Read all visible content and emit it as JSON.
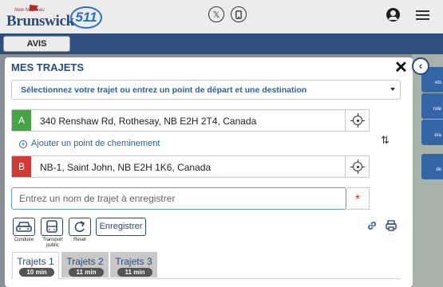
{
  "header": {
    "logo": {
      "small_text": "New Nouveau",
      "brand": "Brunswick",
      "number": "511"
    },
    "social_x_icon": "x-icon",
    "social_phone_icon": "mobile-icon",
    "user_icon": "user-icon",
    "menu_icon": "hamburger-icon"
  },
  "avis_label": "AVIS",
  "side_tabs": [
    "ets",
    "nde",
    "éra",
    "de"
  ],
  "panel": {
    "title": "MES TRAJETS",
    "close": "✕",
    "back": "‹",
    "select_placeholder": "Sélectionnez votre trajet ou entrez un point de départ et une destination",
    "start": {
      "letter": "A",
      "value": "340 Renshaw Rd, Rothesay, NB E2H 2T4, Canada"
    },
    "add_waypoint": "Ajouter un point de cheminement",
    "end": {
      "letter": "B",
      "value": "NB-1, Saint John, NB E2H 1K6, Canada"
    },
    "swap_icon": "⇅",
    "name_placeholder": "Entrez un nom de trajet à enregistrer",
    "required_mark": "*",
    "modes": [
      {
        "label": "Conduire",
        "icon": "car-icon"
      },
      {
        "label": "Transport public",
        "icon": "bus-icon"
      },
      {
        "label": "Reset",
        "icon": "reset-icon"
      }
    ],
    "save_label": "Enregistrer",
    "tabs": [
      {
        "label": "Trajets 1",
        "duration": "10 min",
        "active": true
      },
      {
        "label": "Trajets 2",
        "duration": "11 min",
        "active": false
      },
      {
        "label": "Trajets 3",
        "duration": "11 min",
        "active": false
      }
    ]
  },
  "colors": {
    "brand_blue": "#2a4a7a",
    "link_blue": "#2a5fa8",
    "bar_blue": "#2e4f7e",
    "start_green": "#47a346",
    "end_red": "#d23a36"
  }
}
